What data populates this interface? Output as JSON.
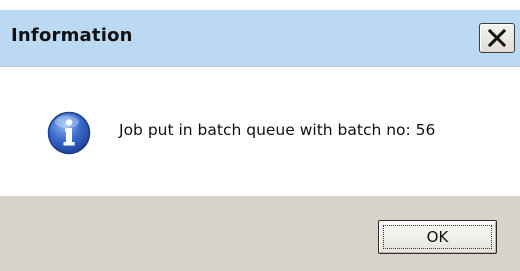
{
  "window": {
    "title": "Information",
    "close_icon": "close-icon"
  },
  "content": {
    "icon": "info-icon",
    "message": "Job put in batch queue with batch no: 56"
  },
  "footer": {
    "ok_label": "OK"
  },
  "colors": {
    "titlebar": "#bcd9f4",
    "footer": "#d7d3cb",
    "info_icon_blue": "#2f63c8"
  }
}
